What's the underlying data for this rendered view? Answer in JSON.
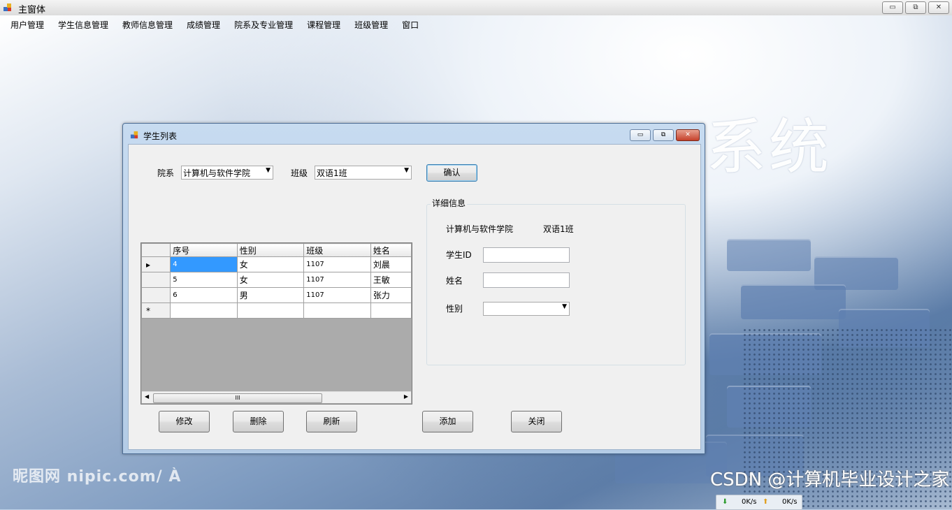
{
  "main_window": {
    "title": "主窗体",
    "min_label": "▭",
    "restore_label": "⧉",
    "close_label": "✕"
  },
  "menu": [
    "用户管理",
    "学生信息管理",
    "教师信息管理",
    "成绩管理",
    "院系及专业管理",
    "课程管理",
    "班级管理",
    "窗口"
  ],
  "background": {
    "title_text": "系统",
    "watermark": "昵图网 nipic.com/ À",
    "csdn": "CSDN @计算机毕业设计之家",
    "net_down": "0K/s",
    "net_up": "0K/s"
  },
  "child": {
    "title": "学生列表",
    "dept_label": "院系",
    "dept_value": "计算机与软件学院",
    "class_label": "班级",
    "class_value": "双语1班",
    "confirm_label": "确认",
    "details": {
      "group_title": "详细信息",
      "dept": "计算机与软件学院",
      "class": "双语1班",
      "student_id_label": "学生ID",
      "name_label": "姓名",
      "gender_label": "性别",
      "student_id_value": "",
      "name_value": "",
      "gender_value": ""
    },
    "grid": {
      "columns": [
        "序号",
        "性别",
        "班级",
        "姓名"
      ],
      "rows": [
        {
          "marker": "▸",
          "no": "4",
          "gender": "女",
          "class": "1107",
          "name": "刘晨"
        },
        {
          "marker": "",
          "no": "5",
          "gender": "女",
          "class": "1107",
          "name": "王敏"
        },
        {
          "marker": "",
          "no": "6",
          "gender": "男",
          "class": "1107",
          "name": "张力"
        }
      ],
      "new_row_marker": "*",
      "scroll_thumb": "III"
    },
    "buttons": {
      "edit": "修改",
      "delete": "删除",
      "refresh": "刷新",
      "add": "添加",
      "close": "关闭"
    }
  }
}
